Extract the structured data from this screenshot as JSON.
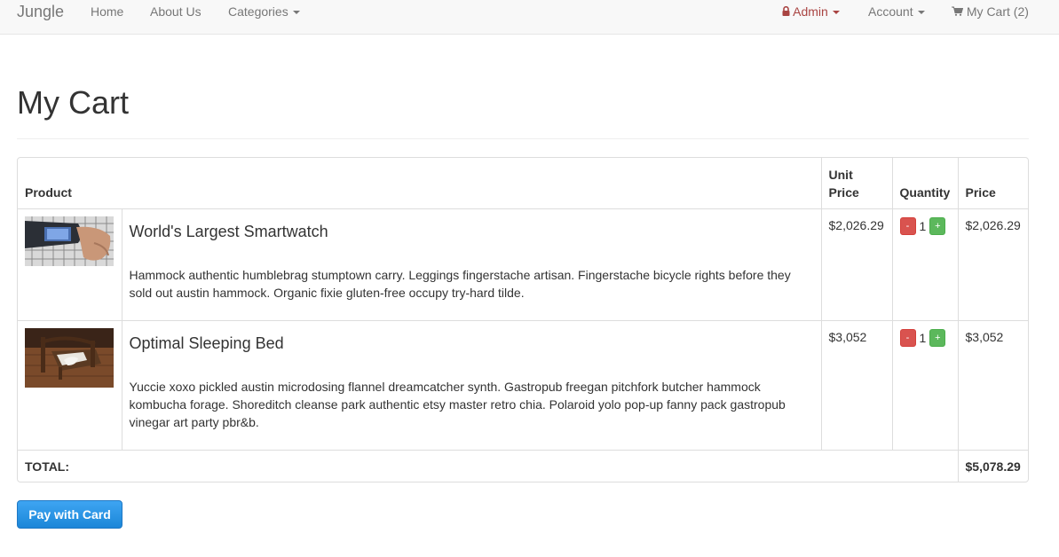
{
  "nav": {
    "brand": "Jungle",
    "home": "Home",
    "about": "About Us",
    "categories": "Categories",
    "admin": "Admin",
    "account": "Account",
    "cart": "My Cart (2)"
  },
  "page": {
    "title": "My Cart"
  },
  "table": {
    "headers": {
      "product": "Product",
      "unit_price": "Unit Price",
      "quantity": "Quantity",
      "price": "Price"
    },
    "items": [
      {
        "name": "World's Largest Smartwatch",
        "description": "Hammock authentic humblebrag stumptown carry. Leggings fingerstache artisan. Fingerstache bicycle rights before they sold out austin hammock. Organic fixie gluten-free occupy try-hard tilde.",
        "unit_price": "$2,026.29",
        "quantity": "1",
        "minus": "-",
        "plus": "+",
        "price": "$2,026.29"
      },
      {
        "name": "Optimal Sleeping Bed",
        "description": "Yuccie xoxo pickled austin microdosing flannel dreamcatcher synth. Gastropub freegan pitchfork butcher hammock kombucha forage. Shoreditch cleanse park authentic etsy master retro chia. Polaroid yolo pop-up fanny pack gastropub vinegar art party pbr&b.",
        "unit_price": "$3,052",
        "quantity": "1",
        "minus": "-",
        "plus": "+",
        "price": "$3,052"
      }
    ],
    "total_label": "TOTAL:",
    "total_value": "$5,078.29"
  },
  "actions": {
    "pay": "Pay with Card"
  },
  "colors": {
    "admin": "#a94442",
    "danger": "#d9534f",
    "success": "#5cb85c",
    "primary": "#1b86d8"
  },
  "icons": {
    "admin": "lock-icon",
    "cart": "shopping-cart-icon",
    "dropdown": "caret-down-icon"
  }
}
